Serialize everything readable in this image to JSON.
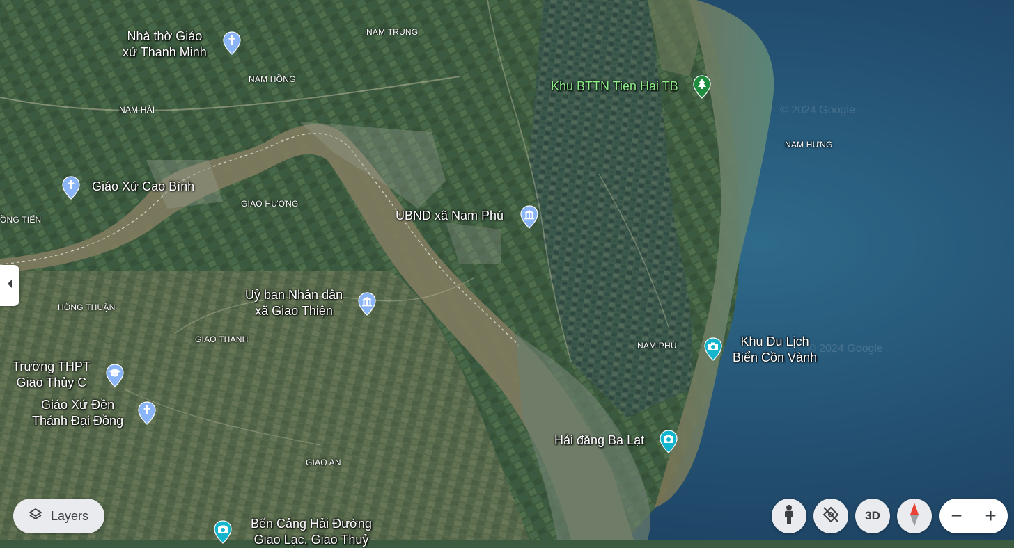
{
  "map": {
    "watermarks": [
      "© 2024 Google",
      "© 2024 Google"
    ],
    "places": [
      {
        "id": "nha-tho",
        "label": "Nhà thờ Giáo\nxứ Thanh Minh",
        "icon": "church-icon"
      },
      {
        "id": "cao-binh",
        "label": "Giáo Xứ Cao Bình",
        "icon": "church-icon"
      },
      {
        "id": "ubnd-nam-phu",
        "label": "UBND xã Nam Phú",
        "icon": "government-building-icon"
      },
      {
        "id": "uy-ban-giao-thien",
        "label": "Uỷ ban Nhân dân\nxã Giao Thiện",
        "icon": "government-building-icon"
      },
      {
        "id": "truong-thpt",
        "label": "Trường THPT\nGiao Thủy C",
        "icon": "school-icon"
      },
      {
        "id": "giao-xu-den",
        "label": "Giáo Xứ Đền\nThánh Đại Đồng",
        "icon": "church-icon"
      },
      {
        "id": "khu-bttn",
        "label": "Khu BTTN Tien Hai TB",
        "icon": "park-tree-icon"
      },
      {
        "id": "khu-du-lich",
        "label": "Khu Du Lịch\nBiển Cồn Vành",
        "icon": "camera-icon"
      },
      {
        "id": "hai-dang",
        "label": "Hải đăng Ba Lạt",
        "icon": "camera-icon"
      },
      {
        "id": "ben-cang",
        "label": "Bến Cảng Hải Đường\nGiao Lạc, Giao Thuỷ",
        "icon": "camera-icon"
      }
    ],
    "areas": [
      "NAM TRUNG",
      "NAM HỒNG",
      "NAM HẢI",
      "NAM HƯNG",
      "GIAO HƯƠNG",
      "ỒNG TIẾN",
      "HỒNG THUẬN",
      "GIAO THANH",
      "NAM PHÚ",
      "GIAO AN"
    ]
  },
  "controls": {
    "layers_label": "Layers",
    "threed_label": "3D",
    "zoom_out": "−",
    "zoom_in": "+",
    "icons": {
      "side": "chevron-left-icon",
      "layers": "layers-icon",
      "pegman": "pegman-icon",
      "tilt": "tilt-off-icon",
      "compass": "compass-icon"
    }
  },
  "colors": {
    "church_pin": "#8ab4f8",
    "camera_pin": "#12b5cb",
    "park_pin": "#1e8e3e"
  }
}
